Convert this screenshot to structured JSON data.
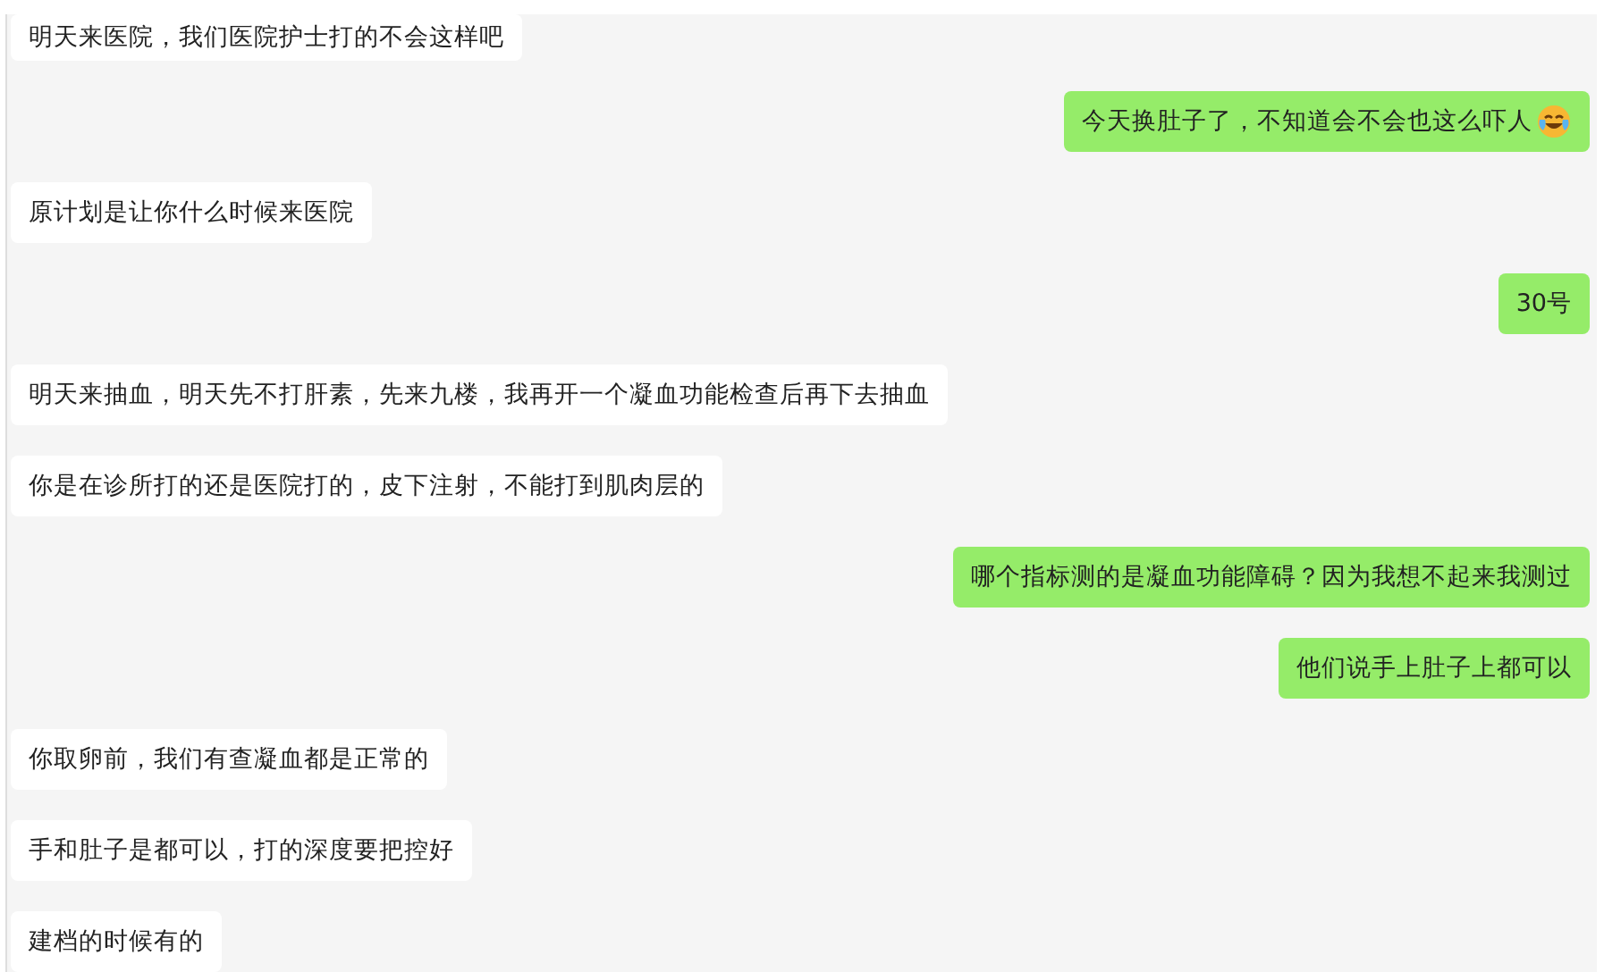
{
  "messages": [
    {
      "kind": "received",
      "text": "明天来医院，我们医院护士打的不会这样吧"
    },
    {
      "kind": "sent",
      "text": "今天换肚子了，不知道会不会也这么吓人",
      "emoji": true
    },
    {
      "kind": "received",
      "text": "原计划是让你什么时候来医院"
    },
    {
      "kind": "sent",
      "text": "30号"
    },
    {
      "kind": "received",
      "text": "明天来抽血，明天先不打肝素，先来九楼，我再开一个凝血功能检查后再下去抽血"
    },
    {
      "kind": "received",
      "text": "你是在诊所打的还是医院打的，皮下注射，不能打到肌肉层的"
    },
    {
      "kind": "sent",
      "text": "哪个指标测的是凝血功能障碍？因为我想不起来我测过"
    },
    {
      "kind": "sent",
      "text": "他们说手上肚子上都可以"
    },
    {
      "kind": "received",
      "text": "你取卵前，我们有查凝血都是正常的"
    },
    {
      "kind": "received",
      "text": "手和肚子是都可以，打的深度要把控好"
    },
    {
      "kind": "received",
      "text": "建档的时候有的"
    }
  ]
}
